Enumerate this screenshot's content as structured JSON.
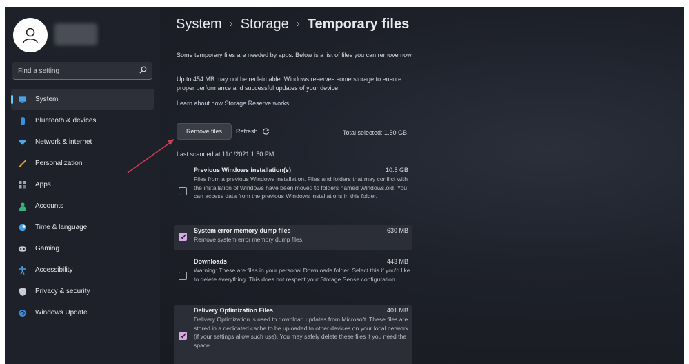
{
  "sidebar": {
    "search_placeholder": "Find a setting",
    "items": [
      {
        "label": "System",
        "icon": "monitor-icon",
        "color": "#4aa3e8",
        "active": true
      },
      {
        "label": "Bluetooth & devices",
        "icon": "bluetooth-icon",
        "color": "#3b8fe0"
      },
      {
        "label": "Network & internet",
        "icon": "wifi-icon",
        "color": "#4da6e8"
      },
      {
        "label": "Personalization",
        "icon": "brush-icon",
        "color": "#e8a03a"
      },
      {
        "label": "Apps",
        "icon": "apps-icon",
        "color": "#9aa7b8"
      },
      {
        "label": "Accounts",
        "icon": "person-icon",
        "color": "#36b37e"
      },
      {
        "label": "Time & language",
        "icon": "globe-icon",
        "color": "#3aa0e8"
      },
      {
        "label": "Gaming",
        "icon": "gamepad-icon",
        "color": "#c9ccd2"
      },
      {
        "label": "Accessibility",
        "icon": "accessibility-icon",
        "color": "#4aa3e8"
      },
      {
        "label": "Privacy & security",
        "icon": "shield-icon",
        "color": "#c9ccd2"
      },
      {
        "label": "Windows Update",
        "icon": "update-icon",
        "color": "#3a8ee6"
      }
    ]
  },
  "breadcrumb": [
    "System",
    "Storage",
    "Temporary files"
  ],
  "main": {
    "intro": "Some temporary files are needed by apps. Below is a list of files you can remove now.",
    "reserve_note": "Up to 454 MB may not be reclaimable. Windows reserves some storage to ensure proper performance and successful updates of your device.",
    "learn_link": "Learn about how Storage Reserve works",
    "remove_button": "Remove files",
    "refresh_button": "Refresh",
    "total_selected": "Total selected: 1.50 GB",
    "last_scanned": "Last scanned at 11/1/2021 1:50 PM",
    "files": [
      {
        "name": "Previous Windows installation(s)",
        "size": "10.5 GB",
        "checked": false,
        "desc": "Files from a previous Windows installation.  Files and folders that may conflict with the installation of Windows have been moved to folders named Windows.old.  You can access data from the previous Windows installations in this folder."
      },
      {
        "name": "System error memory dump files",
        "size": "630 MB",
        "checked": true,
        "desc": "Remove system error memory dump files."
      },
      {
        "name": "Downloads",
        "size": "443 MB",
        "checked": false,
        "desc": "Warning: These are files in your personal Downloads folder. Select this if you'd like to delete everything. This does not respect your Storage Sense configuration."
      },
      {
        "name": "Delivery Optimization Files",
        "size": "401 MB",
        "checked": true,
        "desc": "Delivery Optimization is used to download updates from Microsoft. These files are stored in a dedicated cache to be uploaded to other devices on your local network (if your settings allow such use). You may safely delete these files if you need the space."
      }
    ]
  },
  "colors": {
    "accent": "#60cdff",
    "checkbox": "#d6a8e6",
    "annotation_arrow": "#d23a4e"
  }
}
